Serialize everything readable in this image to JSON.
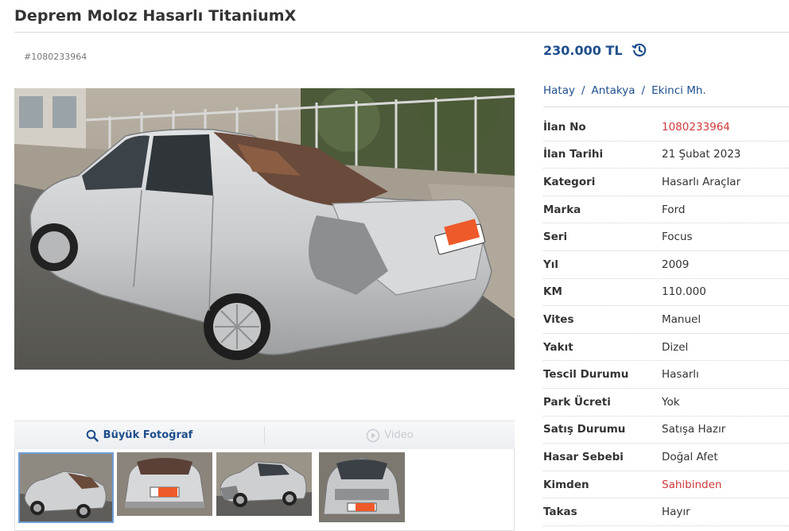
{
  "listing": {
    "title": "Deprem Moloz Hasarlı TitaniumX",
    "ad_id_label": "#1080233964",
    "price": "230.000 TL"
  },
  "breadcrumb": [
    "Hatay",
    "Antakya",
    "Ekinci Mh."
  ],
  "breadcrumb_separator": "/",
  "details": [
    {
      "key": "İlan No",
      "value": "1080233964",
      "highlight": true
    },
    {
      "key": "İlan Tarihi",
      "value": "21 Şubat 2023"
    },
    {
      "key": "Kategori",
      "value": "Hasarlı Araçlar"
    },
    {
      "key": "Marka",
      "value": "Ford"
    },
    {
      "key": "Seri",
      "value": "Focus"
    },
    {
      "key": "Yıl",
      "value": "2009"
    },
    {
      "key": "KM",
      "value": "110.000"
    },
    {
      "key": "Vites",
      "value": "Manuel"
    },
    {
      "key": "Yakıt",
      "value": "Dizel"
    },
    {
      "key": "Tescil Durumu",
      "value": "Hasarlı"
    },
    {
      "key": "Park Ücreti",
      "value": "Yok"
    },
    {
      "key": "Satış Durumu",
      "value": "Satışa Hazır"
    },
    {
      "key": "Hasar Sebebi",
      "value": "Doğal Afet"
    },
    {
      "key": "Kimden",
      "value": "Sahibinden",
      "highlight": true
    },
    {
      "key": "Takas",
      "value": "Hayır"
    }
  ],
  "media": {
    "big_photo_label": "Büyük Fotoğraf",
    "video_label": "Video"
  },
  "colors": {
    "brand_blue": "#1f4e8c",
    "highlight_red": "#d0393b",
    "car_silver": "#c9cbcd"
  },
  "icons": {
    "price_history": "history-clock-icon",
    "big_photo": "magnifier-icon",
    "video": "play-circle-icon"
  }
}
